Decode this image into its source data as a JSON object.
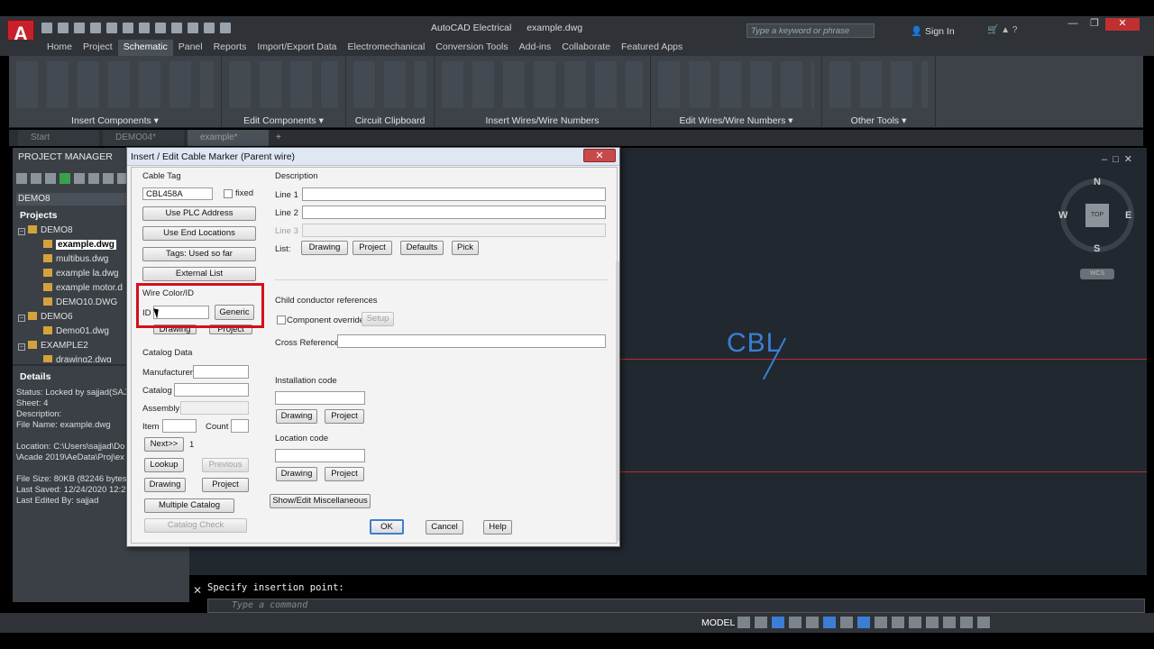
{
  "app": {
    "logo": "A",
    "title": "AutoCAD Electrical",
    "file": "example.dwg",
    "search_placeholder": "Type a keyword or phrase",
    "signin": "Sign In"
  },
  "ribbon_tabs": [
    "Home",
    "Project",
    "Schematic",
    "Panel",
    "Reports",
    "Import/Export Data",
    "Electromechanical",
    "Conversion Tools",
    "Add-ins",
    "Collaborate",
    "Featured Apps"
  ],
  "ribbon_active_tab": "Schematic",
  "ribbon_groups": [
    {
      "label": "Insert Components ▾"
    },
    {
      "label": "Edit Components ▾"
    },
    {
      "label": "Circuit Clipboard"
    },
    {
      "label": "Insert Wires/Wire Numbers"
    },
    {
      "label": "Edit Wires/Wire Numbers ▾"
    },
    {
      "label": "Other Tools ▾"
    }
  ],
  "doc_tabs": [
    {
      "label": "Start"
    },
    {
      "label": "DEMO04*"
    },
    {
      "label": "example*"
    }
  ],
  "project_manager": {
    "title": "PROJECT MANAGER",
    "current_project": "DEMO8",
    "projects_label": "Projects",
    "tree": [
      {
        "label": "DEMO8",
        "kind": "project"
      },
      {
        "label": "example.dwg",
        "kind": "file",
        "selected": true
      },
      {
        "label": "multibus.dwg",
        "kind": "file"
      },
      {
        "label": "example la.dwg",
        "kind": "file"
      },
      {
        "label": "example motor.d",
        "kind": "file"
      },
      {
        "label": "DEMO10.DWG",
        "kind": "file"
      },
      {
        "label": "DEMO6",
        "kind": "project"
      },
      {
        "label": "Demo01.dwg",
        "kind": "file"
      },
      {
        "label": "EXAMPLE2",
        "kind": "project"
      },
      {
        "label": "drawing2.dwg",
        "kind": "file"
      }
    ],
    "details_title": "Details",
    "details": [
      "Status: Locked by sajjad(SAJ",
      "Sheet: 4",
      "Description:",
      "File Name: example.dwg",
      "",
      "Location: C:\\Users\\sajjad\\Do",
      "\\Acade 2019\\AeData\\Proj\\ex",
      "",
      "File Size: 80KB (82246 bytes)",
      "Last Saved: 12/24/2020 12:22",
      "Last Edited By: sajjad"
    ]
  },
  "canvas": {
    "cable_label": "CBL",
    "viewcube": {
      "top": "TOP",
      "n": "N",
      "s": "S",
      "e": "E",
      "w": "W",
      "wcs": "WCS"
    }
  },
  "dialog": {
    "title": "Insert / Edit Cable Marker (Parent wire)",
    "close": "✕",
    "cable_tag_label": "Cable Tag",
    "cable_tag_value": "CBL458A",
    "fixed_label": "fixed",
    "use_plc_address": "Use PLC Address",
    "use_end_locations": "Use End Locations",
    "tags_used_so_far": "Tags: Used so far",
    "external_list": "External List",
    "wire_color_label": "Wire Color/ID",
    "id_label": "ID",
    "id_value": "",
    "generic": "Generic",
    "drawing": "Drawing",
    "project": "Project",
    "catalog_data_label": "Catalog Data",
    "manufacturer_label": "Manufacturer",
    "catalog_label": "Catalog",
    "assembly_label": "Assembly",
    "item_label": "Item",
    "count_label": "Count",
    "next": "Next>>",
    "next_count": "1",
    "lookup": "Lookup",
    "previous": "Previous",
    "multiple_catalog": "Multiple Catalog",
    "catalog_check": "Catalog Check",
    "description_label": "Description",
    "line1_label": "Line 1",
    "line2_label": "Line 2",
    "line3_label": "Line 3",
    "list_label": "List:",
    "defaults": "Defaults",
    "pick": "Pick",
    "child_conductor_label": "Child conductor references",
    "component_override": "Component override",
    "setup": "Setup",
    "cross_reference_label": "Cross Reference",
    "installation_code_label": "Installation code",
    "location_code_label": "Location code",
    "show_edit_misc": "Show/Edit Miscellaneous",
    "ok": "OK",
    "cancel": "Cancel",
    "help": "Help"
  },
  "command_line": {
    "history": "Specify insertion point:",
    "placeholder": "Type a command"
  },
  "status_bar": {
    "model": "MODEL",
    "scale": "1:1"
  },
  "colors": {
    "accent": "#3c7fd3",
    "wire_red": "#c02a2a",
    "highlight_red": "#d4101a",
    "canvas_bg": "#212830"
  }
}
